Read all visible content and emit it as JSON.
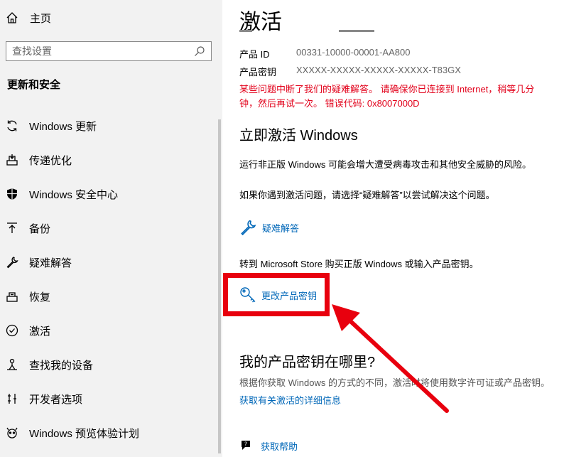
{
  "sidebar": {
    "home_label": "主页",
    "search_placeholder": "查找设置",
    "section_title": "更新和安全",
    "items": [
      {
        "label": "Windows 更新",
        "icon": "refresh-icon"
      },
      {
        "label": "传递优化",
        "icon": "delivery-optimization-icon"
      },
      {
        "label": "Windows 安全中心",
        "icon": "shield-icon"
      },
      {
        "label": "备份",
        "icon": "backup-icon"
      },
      {
        "label": "疑难解答",
        "icon": "wrench-icon"
      },
      {
        "label": "恢复",
        "icon": "recovery-icon"
      },
      {
        "label": "激活",
        "icon": "activation-check-icon"
      },
      {
        "label": "查找我的设备",
        "icon": "find-device-icon"
      },
      {
        "label": "开发者选项",
        "icon": "developer-icon"
      },
      {
        "label": "Windows 预览体验计划",
        "icon": "insider-icon"
      }
    ]
  },
  "main": {
    "title": "激活",
    "product_id_label": "产品 ID",
    "product_id_value": "00331-10000-00001-AA800",
    "product_key_label": "产品密钥",
    "product_key_value": "XXXXX-XXXXX-XXXXX-XXXXX-T83GX",
    "error_text": "某些问题中断了我们的疑难解答。 请确保你已连接到 Internet，稍等几分钟，然后再试一次。 错误代码: 0x8007000D",
    "activate_heading": "立即激活 Windows",
    "warning_text": "运行非正版 Windows 可能会增大遭受病毒攻击和其他安全威胁的风险。",
    "troubleshoot_hint": "如果你遇到激活问题，请选择“疑难解答”以尝试解决这个问题。",
    "troubleshoot_link": "疑难解答",
    "store_text": "转到 Microsoft Store 购买正版 Windows 或输入产品密钥。",
    "change_key_link": "更改产品密钥",
    "where_key_heading": "我的产品密钥在哪里?",
    "where_key_text": "根据你获取 Windows 的方式的不同，激活时将使用数字许可证或产品密钥。",
    "more_info_link": "获取有关激活的详细信息",
    "help_link": "获取帮助"
  },
  "colors": {
    "sidebar_bg": "#f2f2f2",
    "link": "#0067b8",
    "error": "#e2001a",
    "annotation": "#e8000e"
  }
}
